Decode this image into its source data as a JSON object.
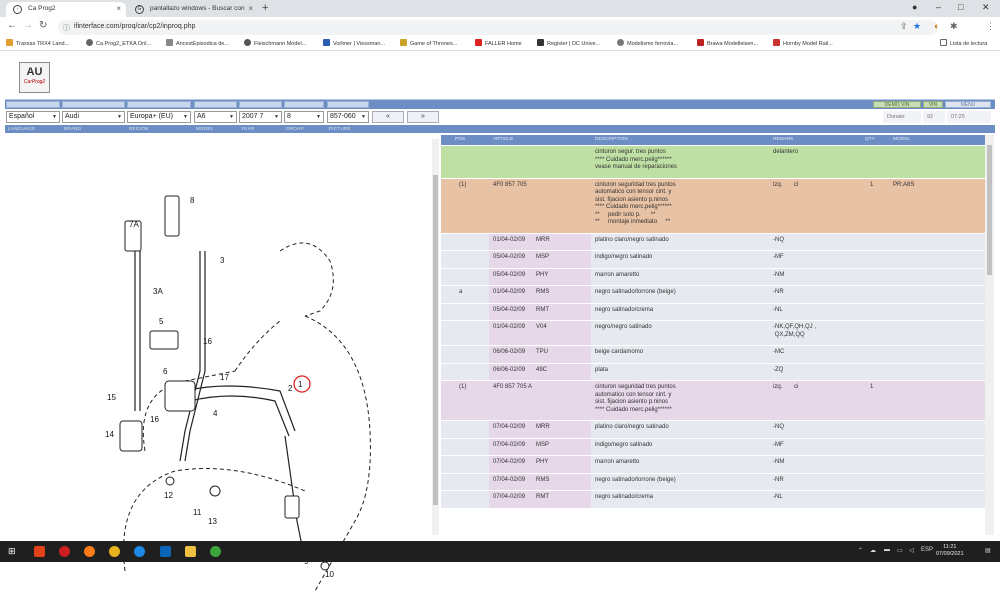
{
  "browser": {
    "tabs": [
      {
        "title": "Ca Prog2",
        "icon": "globe-icon"
      },
      {
        "title": "pantallazo windows - Buscar con",
        "icon": "google-icon"
      }
    ],
    "url": "ifinterface.com/proq/car/cp2/inproq.php",
    "bookmarks": [
      "Traxxas TRX4 Land...",
      "Ca Prog2_ETKA Onl...",
      "AncestEpisodica de...",
      "Fleischmann Model...",
      "Vorlmer | Viessman...",
      "Game of Thrones...",
      "FALLER Home",
      "Register | DC Unive...",
      "Modelismo ferrovia...",
      "Brawa Modelleisen...",
      "Hornby Model Rail..."
    ],
    "reading_list": "Lista de lectura"
  },
  "app": {
    "logo_text": "AU",
    "logo_sub": "CarProg2",
    "top_buttons": [
      "DEMO VIN",
      "VIN",
      "MENU"
    ],
    "selectors": [
      {
        "name": "language",
        "value": "Español",
        "label": "LANGUAGE"
      },
      {
        "name": "brand",
        "value": "Audi",
        "label": "BRAND"
      },
      {
        "name": "region",
        "value": "Europa+ (EU)",
        "label": "REGION"
      },
      {
        "name": "model",
        "value": "A6",
        "label": "MODEL"
      },
      {
        "name": "year",
        "value": "2007  7",
        "label": "YEAR"
      },
      {
        "name": "group",
        "value": "8",
        "label": "GROUP"
      },
      {
        "name": "picture",
        "value": "857-060",
        "label": "PICTURE"
      }
    ],
    "prev": "«",
    "next": "»",
    "meta": {
      "donate": "Donate",
      "count": "92",
      "time": "07:25"
    }
  },
  "diagram": {
    "callouts": [
      "8",
      "7A",
      "3",
      "3A",
      "5",
      "16",
      "6",
      "17",
      "1",
      "2",
      "4",
      "15",
      "16",
      "14",
      "12",
      "11",
      "13",
      "9",
      "10"
    ]
  },
  "table": {
    "headers": [
      "POS",
      "ARTICLE",
      "DESCRIPTION",
      "REMARK",
      "QTY",
      "MODEL"
    ],
    "rows": [
      {
        "type": "green",
        "pos": "",
        "date": "",
        "code": "",
        "desc": "cinturon segur. tres puntos\n**** Cuidado merc.pelig******\nvease manual de reparaciones",
        "remark": "delantero",
        "qty": "",
        "model": ""
      },
      {
        "type": "orange",
        "pos": "(1)",
        "date": "4F0 857 705",
        "code": "",
        "desc": "cinturon seguridad tres puntos\nautomatico con tensor cint. y\nsist. fijacion asiento p.ninos\n**** Cuidado merc.pelig******\n**     pedir solo p.      **\n**     montaje inmediato     **",
        "remark": "izq.       ci",
        "qty": "1",
        "model": "PR:A8S"
      },
      {
        "type": "grey",
        "pos": "",
        "date": "01/04-02/09",
        "code": "MRR",
        "desc": "platino claro/negro satinado",
        "remark": "-NQ",
        "qty": "",
        "model": ""
      },
      {
        "type": "grey",
        "pos": "",
        "date": "05/04-02/09",
        "code": "MSP",
        "desc": "indigo/negro satinado",
        "remark": "-MF",
        "qty": "",
        "model": ""
      },
      {
        "type": "grey",
        "pos": "",
        "date": "05/04-02/09",
        "code": "PHY",
        "desc": "marron amaretto",
        "remark": "-NM",
        "qty": "",
        "model": ""
      },
      {
        "type": "grey",
        "pos": "a",
        "date": "01/04-02/09",
        "code": "RMS",
        "desc": "negro satinado/torrone (beige)",
        "remark": "-NR",
        "qty": "",
        "model": ""
      },
      {
        "type": "grey",
        "pos": "",
        "date": "05/04-02/09",
        "code": "RMT",
        "desc": "negro satinado/crema",
        "remark": "-NL",
        "qty": "",
        "model": ""
      },
      {
        "type": "grey",
        "pos": "",
        "date": "01/04-02/09",
        "code": "V04",
        "desc": "negro/negro satinado",
        "remark": "-NK,QF,QH,QJ ,\n QX,ZM,QQ",
        "qty": "",
        "model": ""
      },
      {
        "type": "grey",
        "pos": "",
        "date": "06/06-02/09",
        "code": "TPU",
        "desc": "beige cardamomo",
        "remark": "-MC",
        "qty": "",
        "model": ""
      },
      {
        "type": "grey",
        "pos": "",
        "date": "06/06-02/09",
        "code": "49C",
        "desc": "plata",
        "remark": "-ZQ",
        "qty": "",
        "model": ""
      },
      {
        "type": "pink",
        "pos": "(1)",
        "date": "4F0 857 705 A",
        "code": "",
        "desc": "cinturon seguridad tres puntos\nautomatico con tensor cint. y\nsist. fijacion asiento p.ninos\n**** Cuidado merc.pelig******",
        "remark": "izq.       ci",
        "qty": "1",
        "model": ""
      },
      {
        "type": "grey",
        "pos": "",
        "date": "07/04-02/09",
        "code": "MRR",
        "desc": "platino claro/negro satinado",
        "remark": "-NQ",
        "qty": "",
        "model": ""
      },
      {
        "type": "grey",
        "pos": "",
        "date": "07/04-02/09",
        "code": "MSP",
        "desc": "indigo/negro satinado",
        "remark": "-MF",
        "qty": "",
        "model": ""
      },
      {
        "type": "grey",
        "pos": "",
        "date": "07/04-02/09",
        "code": "PHY",
        "desc": "marron amaretto",
        "remark": "-NM",
        "qty": "",
        "model": ""
      },
      {
        "type": "grey",
        "pos": "",
        "date": "07/04-02/09",
        "code": "RMS",
        "desc": "negro satinado/torrone (beige)",
        "remark": "-NR",
        "qty": "",
        "model": ""
      },
      {
        "type": "grey",
        "pos": "",
        "date": "07/04-02/09",
        "code": "RMT",
        "desc": "negro satinado/crema",
        "remark": "-NL",
        "qty": "",
        "model": ""
      }
    ]
  },
  "taskbar": {
    "lang": "ESP",
    "time": "11:21",
    "date": "07/09/2021"
  }
}
